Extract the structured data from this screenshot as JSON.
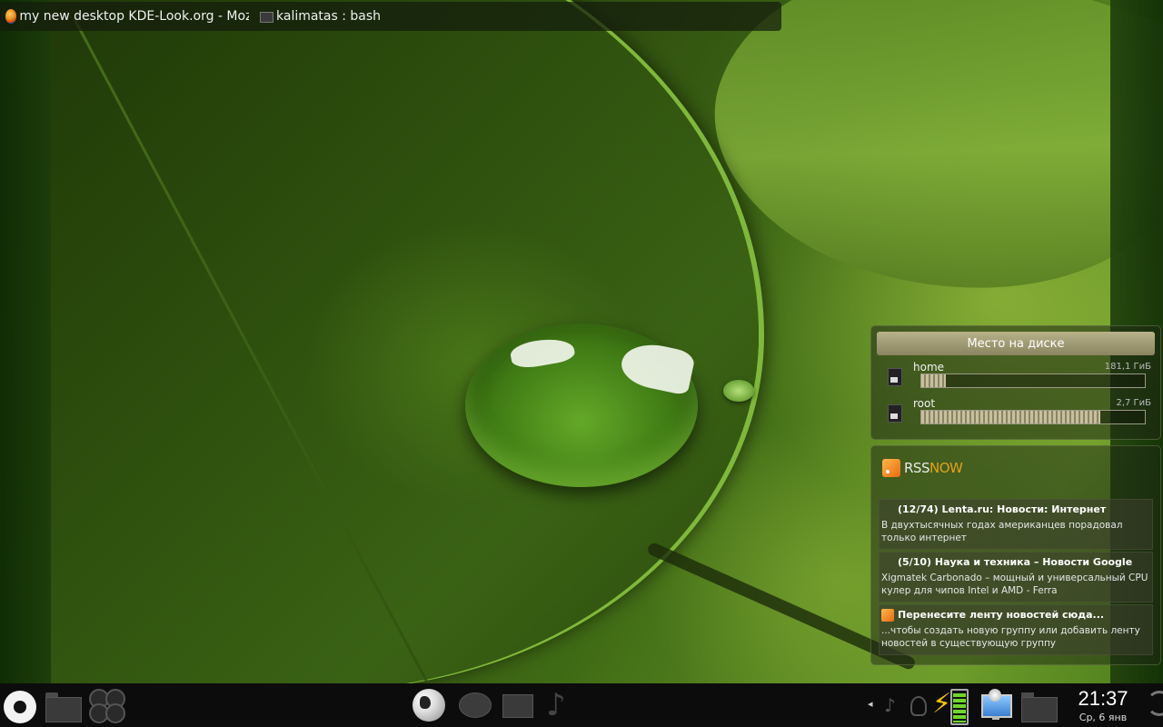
{
  "taskbar": {
    "tasks": [
      {
        "label": "my new desktop KDE-Look.org - Mozilla Firefox",
        "icon": "firefox-icon"
      },
      {
        "label": "kalimatas : bash",
        "icon": "terminal-icon"
      }
    ]
  },
  "disk_widget": {
    "title": "Место на диске",
    "disks": [
      {
        "name": "home",
        "size": "181,1 ГиБ",
        "used_fraction": 0.11,
        "icon": "hdd-icon"
      },
      {
        "name": "root",
        "size": "2,7 ГиБ",
        "used_fraction": 0.8,
        "icon": "hdd-icon"
      }
    ]
  },
  "rss_widget": {
    "logo_part1": "RSS",
    "logo_part2": "NOW",
    "items": [
      {
        "title": "(12/74) Lenta.ru: Новости: Интернет",
        "text": "В двухтысячных годах американцев порадовал только интернет"
      },
      {
        "title": "(5/10) Наука и техника – Новости Google",
        "text": "Xigmatek Carbonado – мощный и универсальный CPU кулер для чипов Intel и AMD - Ferra"
      },
      {
        "title": "Перенесите ленту новостей сюда...",
        "text": "...чтобы создать новую группу или добавить ленту новостей в существующую группу"
      }
    ]
  },
  "panel": {
    "clock_time": "21:37",
    "clock_date": "Ср, 6 янв",
    "battery_level": 0.9,
    "accent_battery": "#6fd62a",
    "accent_power": "#f5c400"
  }
}
